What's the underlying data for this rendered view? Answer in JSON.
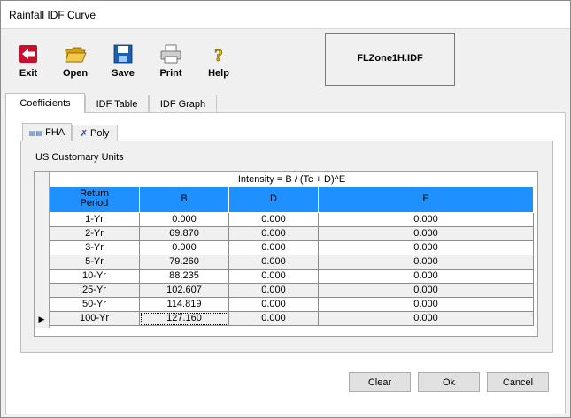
{
  "window": {
    "title": "Rainfall IDF Curve"
  },
  "toolbar": {
    "exit_label": "Exit",
    "open_label": "Open",
    "save_label": "Save",
    "print_label": "Print",
    "help_label": "Help"
  },
  "file_name": "FLZone1H.IDF",
  "main_tabs": [
    "Coefficients",
    "IDF Table",
    "IDF Graph"
  ],
  "sub_tabs": [
    "FHA",
    "Poly"
  ],
  "units_label": "US Customary Units",
  "grid": {
    "formula": "Intensity = B / (Tc + D)^E",
    "headers": [
      "Return\nPeriod",
      "B",
      "D",
      "E"
    ],
    "rows": [
      {
        "period": "1-Yr",
        "b": "0.000",
        "d": "0.000",
        "e": "0.000"
      },
      {
        "period": "2-Yr",
        "b": "69.870",
        "d": "0.000",
        "e": "0.000"
      },
      {
        "period": "3-Yr",
        "b": "0.000",
        "d": "0.000",
        "e": "0.000"
      },
      {
        "period": "5-Yr",
        "b": "79.260",
        "d": "0.000",
        "e": "0.000"
      },
      {
        "period": "10-Yr",
        "b": "88.235",
        "d": "0.000",
        "e": "0.000"
      },
      {
        "period": "25-Yr",
        "b": "102.607",
        "d": "0.000",
        "e": "0.000"
      },
      {
        "period": "50-Yr",
        "b": "114.819",
        "d": "0.000",
        "e": "0.000"
      },
      {
        "period": "100-Yr",
        "b": "127.160",
        "d": "0.000",
        "e": "0.000"
      }
    ],
    "current_row_indicator": "▶"
  },
  "buttons": {
    "clear_label": "Clear",
    "ok_label": "Ok",
    "cancel_label": "Cancel"
  },
  "colors": {
    "header_bg": "#1e90ff",
    "row_alt": "#f0f0f0"
  }
}
